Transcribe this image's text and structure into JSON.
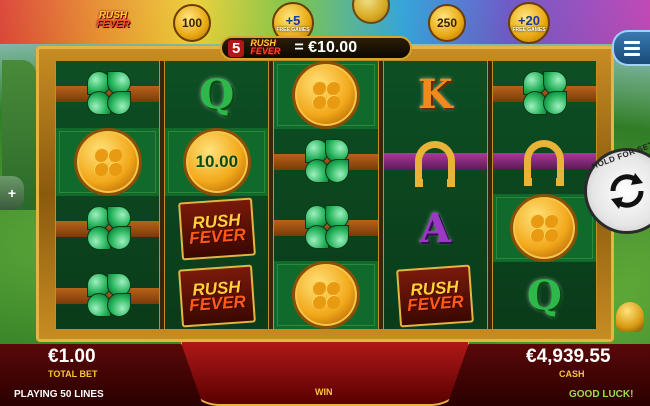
{
  "top_bar": {
    "logo_line1": "RUSH",
    "logo_line2": "FEVER",
    "prize_coin_1": "100",
    "prize_fg_1_value": "+5",
    "prize_fg_1_label": "FREE GAMES",
    "prize_coin_2": "250",
    "prize_fg_2_value": "+20",
    "prize_fg_2_label": "FREE GAMES"
  },
  "bet_banner": {
    "lines": "5",
    "logo_line1": "RUSH",
    "logo_line2": "FEVER",
    "value": "= €10.00"
  },
  "reels": [
    [
      "clover",
      "coin",
      "clover",
      "clover"
    ],
    [
      "Q",
      "coin:10.00",
      "rush-fever",
      "rush-fever"
    ],
    [
      "coin",
      "clover",
      "clover",
      "coin"
    ],
    [
      "K",
      "horseshoe",
      "A",
      "rush-fever"
    ],
    [
      "clover",
      "horseshoe",
      "coin",
      "Q"
    ]
  ],
  "symbols": {
    "coin_value": "10.00",
    "letter_q": "Q",
    "letter_k": "K",
    "letter_a": "A",
    "rush_line1": "RUSH",
    "rush_line2": "FEVER"
  },
  "spin_button": {
    "hold_label": "HOLD FOR SET"
  },
  "side_button": {
    "label": "+"
  },
  "footer": {
    "total_bet_value": "€1.00",
    "total_bet_label": "TOTAL BET",
    "win_label": "WIN",
    "cash_value": "€4,939.55",
    "cash_label": "CASH",
    "lines_text": "PLAYING 50 LINES",
    "status_text": "GOOD LUCK!"
  },
  "colors": {
    "frame_gold": "#e6b443",
    "reel_green": "#0d4f23",
    "bar_red": "#b01818",
    "label_yellow": "#f5c93a",
    "good_luck_green": "#9ae04a"
  }
}
